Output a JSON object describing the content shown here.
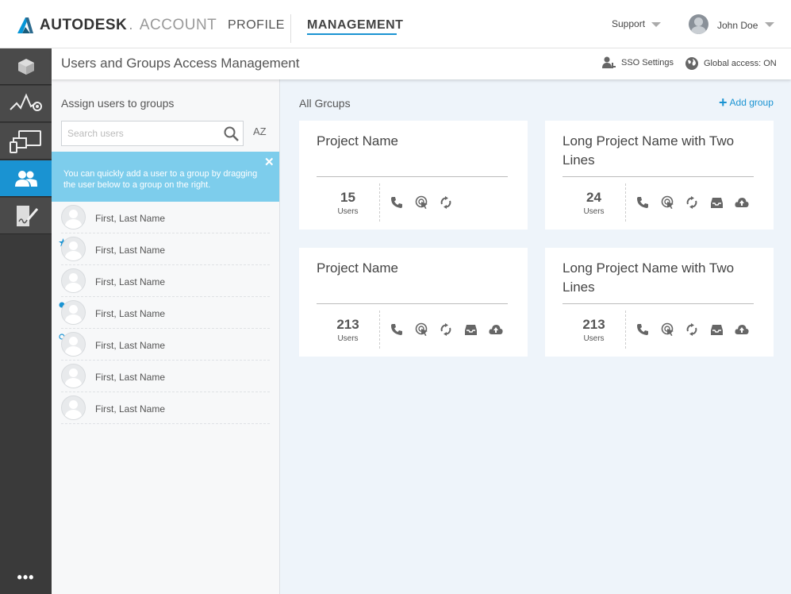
{
  "topbar": {
    "brand": "AUTODESK",
    "product": "ACCOUNT",
    "nav": {
      "profile": "PROFILE",
      "management": "MANAGEMENT"
    },
    "support": "Support",
    "user_name": "John Doe"
  },
  "rail": {
    "items": [
      "box-icon",
      "analytics-icon",
      "devices-icon",
      "users-icon",
      "document-signature-icon"
    ],
    "active": "users-icon",
    "more": "•••"
  },
  "header": {
    "title": "Users and Groups Access Management",
    "sso": "SSO Settings",
    "global_access": "Global access: ON"
  },
  "users_panel": {
    "title": "Assign users to groups",
    "search_placeholder": "Search users",
    "sort_label": "AZ",
    "tip": "You can quickly add a user to a group by dragging the user below to a group on the right.",
    "tip_close": "✕",
    "users": [
      {
        "name": "First, Last Name",
        "marker": "none"
      },
      {
        "name": "First, Last Name",
        "marker": "star"
      },
      {
        "name": "First, Last Name",
        "marker": "none"
      },
      {
        "name": "First, Last Name",
        "marker": "dot-filled"
      },
      {
        "name": "First, Last Name",
        "marker": "dot-outline"
      },
      {
        "name": "First, Last Name",
        "marker": "none"
      },
      {
        "name": "First, Last Name",
        "marker": "none"
      }
    ]
  },
  "groups": {
    "title": "All Grcups",
    "add_label": "Add group",
    "cards": [
      {
        "title": "Project Name",
        "count": "15",
        "count_label": "Users",
        "icons": [
          "phone-icon",
          "cursor-click-icon",
          "sync-icon"
        ]
      },
      {
        "title": "Long Project Name with Two Lines",
        "count": "24",
        "count_label": "Users",
        "icons": [
          "phone-icon",
          "cursor-click-icon",
          "sync-icon",
          "inbox-icon",
          "cloud-upload-icon"
        ]
      },
      {
        "title": "Project Name",
        "count": "213",
        "count_label": "Users",
        "icons": [
          "phone-icon",
          "cursor-click-icon",
          "sync-icon",
          "inbox-icon",
          "cloud-upload-icon"
        ]
      },
      {
        "title": "Long Project Name with Two Lines",
        "count": "213",
        "count_label": "Users",
        "icons": [
          "phone-icon",
          "cursor-click-icon",
          "sync-icon",
          "inbox-icon",
          "cloud-upload-icon"
        ]
      }
    ]
  },
  "colors": {
    "accent": "#1a93d2",
    "tip_bg": "#7dcdec",
    "rail_bg": "#3a3a3a",
    "groups_bg": "#eef4fa"
  }
}
